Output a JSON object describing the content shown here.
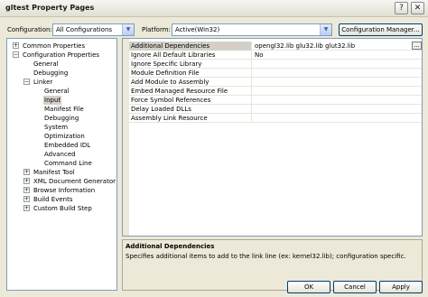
{
  "window": {
    "title": "gltest Property Pages",
    "help_glyph": "?",
    "close_glyph": "✕"
  },
  "toolbar": {
    "configuration_label": "Configuration:",
    "configuration_value": "All Configurations",
    "platform_label": "Platform:",
    "platform_value": "Active(Win32)",
    "configuration_manager_label": "Configuration Manager..."
  },
  "tree": [
    {
      "label": "Common Properties",
      "expander": "+"
    },
    {
      "label": "Configuration Properties",
      "expander": "−"
    },
    {
      "label": "General",
      "expander": ""
    },
    {
      "label": "Debugging",
      "expander": ""
    },
    {
      "label": "Linker",
      "expander": "−"
    },
    {
      "label": "General",
      "expander": ""
    },
    {
      "label": "Input",
      "expander": "",
      "selected": true
    },
    {
      "label": "Manifest File",
      "expander": ""
    },
    {
      "label": "Debugging",
      "expander": ""
    },
    {
      "label": "System",
      "expander": ""
    },
    {
      "label": "Optimization",
      "expander": ""
    },
    {
      "label": "Embedded IDL",
      "expander": ""
    },
    {
      "label": "Advanced",
      "expander": ""
    },
    {
      "label": "Command Line",
      "expander": ""
    },
    {
      "label": "Manifest Tool",
      "expander": "+"
    },
    {
      "label": "XML Document Generator",
      "expander": "+"
    },
    {
      "label": "Browse Information",
      "expander": "+"
    },
    {
      "label": "Build Events",
      "expander": "+"
    },
    {
      "label": "Custom Build Step",
      "expander": "+"
    }
  ],
  "properties": [
    {
      "name": "Additional Dependencies",
      "value": "opengl32.lib glu32.lib glut32.lib",
      "selected": true
    },
    {
      "name": "Ignore All Default Libraries",
      "value": "No"
    },
    {
      "name": "Ignore Specific Library",
      "value": ""
    },
    {
      "name": "Module Definition File",
      "value": ""
    },
    {
      "name": "Add Module to Assembly",
      "value": ""
    },
    {
      "name": "Embed Managed Resource File",
      "value": ""
    },
    {
      "name": "Force Symbol References",
      "value": ""
    },
    {
      "name": "Delay Loaded DLLs",
      "value": ""
    },
    {
      "name": "Assembly Link Resource",
      "value": ""
    }
  ],
  "ellipsis_label": "...",
  "description": {
    "title": "Additional Dependencies",
    "text": "Specifies additional items to add to the link line (ex: kernel32.lib); configuration specific."
  },
  "buttons": {
    "ok": "OK",
    "cancel": "Cancel",
    "apply": "Apply"
  }
}
